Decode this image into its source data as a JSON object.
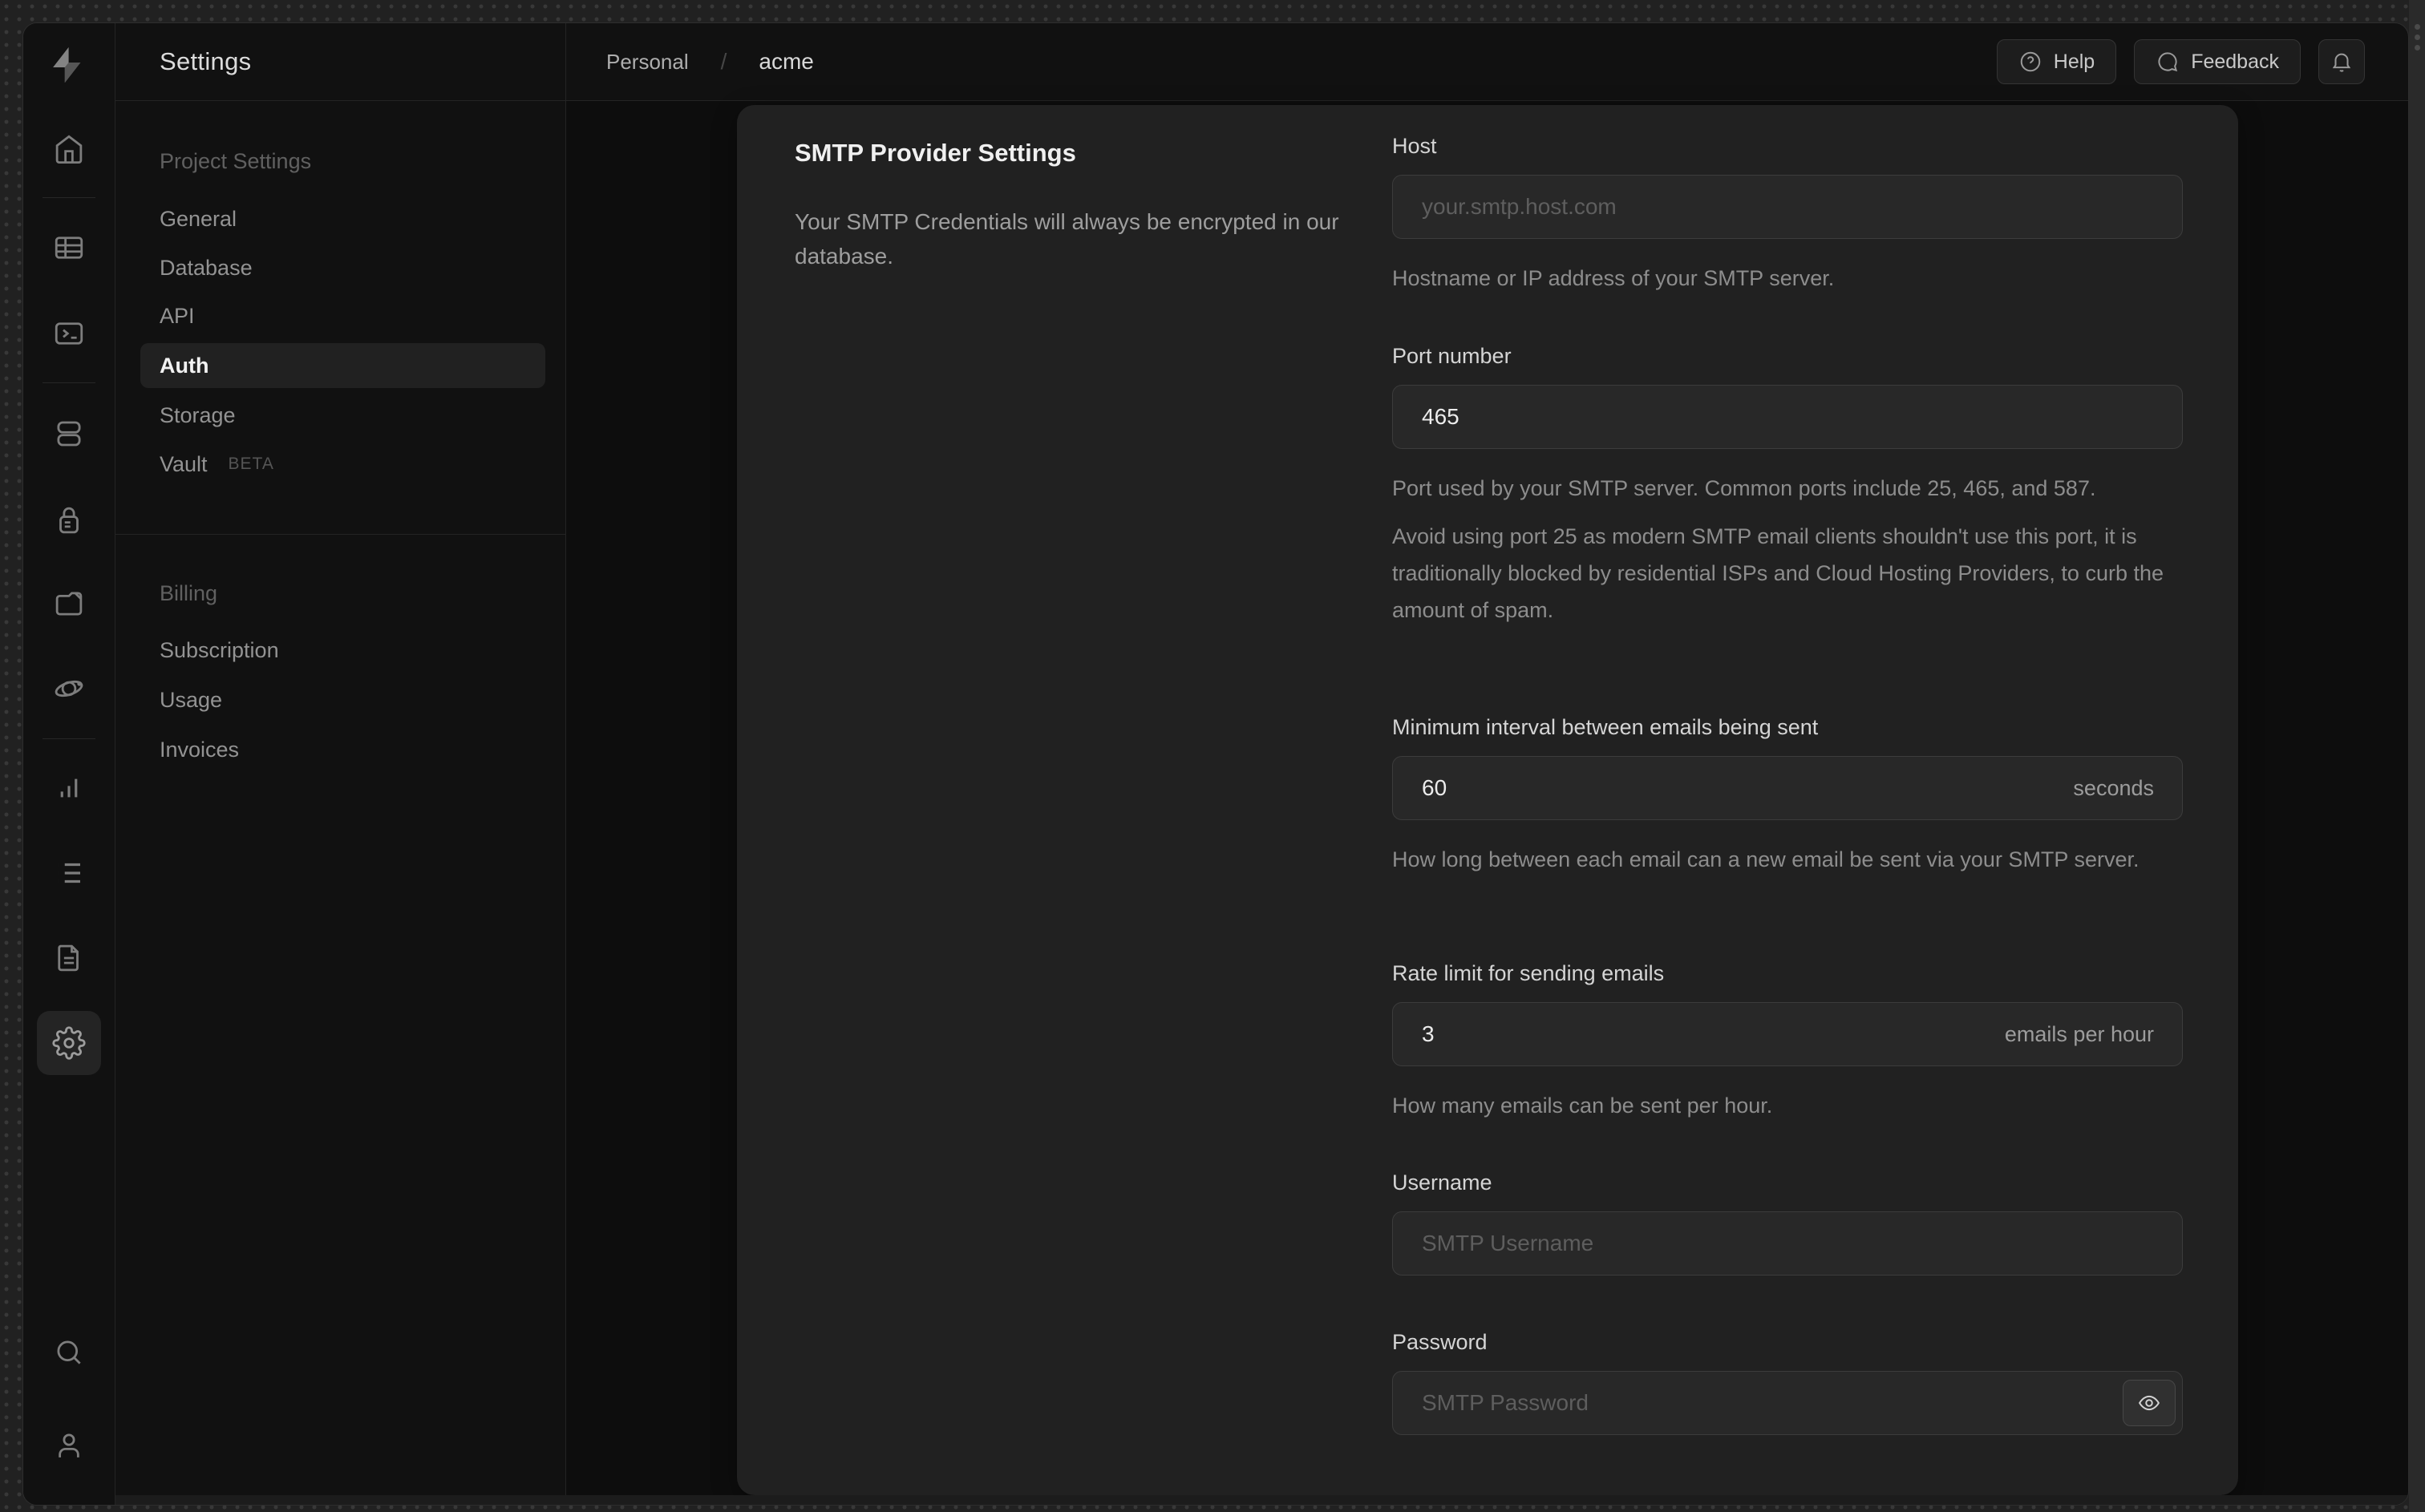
{
  "page_title": "Settings",
  "breadcrumb": {
    "org": "Personal",
    "separator": "/",
    "project": "acme"
  },
  "topbar_actions": {
    "help": "Help",
    "feedback": "Feedback",
    "notifications_icon": "bell-icon"
  },
  "rail_icons": [
    "supabase-logo",
    "home",
    "table-editor",
    "sql-editor",
    "database",
    "authentication",
    "storage",
    "edge-functions",
    "reports",
    "logs",
    "api-docs",
    "project-settings",
    "search",
    "account"
  ],
  "nav": {
    "project_section": {
      "header": "Project Settings",
      "items": [
        "General",
        "Database",
        "API",
        "Auth",
        "Storage",
        "Vault"
      ],
      "active_item": "Auth",
      "vault_beta": "BETA"
    },
    "billing_section": {
      "header": "Billing",
      "items": [
        "Subscription",
        "Usage",
        "Invoices"
      ]
    }
  },
  "smtp_card": {
    "title": "SMTP Provider Settings",
    "description": "Your SMTP Credentials will always be encrypted in our database.",
    "fields": {
      "host": {
        "label": "Host",
        "placeholder": "your.smtp.host.com",
        "helper": "Hostname or IP address of your SMTP server."
      },
      "port": {
        "label": "Port number",
        "value": "465",
        "helper_1": "Port used by your SMTP server. Common ports include 25, 465, and 587.",
        "helper_2": "Avoid using port 25 as modern SMTP email clients shouldn't use this port, it is traditionally blocked by residential ISPs and Cloud Hosting Providers, to curb the amount of spam."
      },
      "min_interval": {
        "label": "Minimum interval between emails being sent",
        "value": "60",
        "suffix": "seconds",
        "helper": "How long between each email can a new email be sent via your SMTP server."
      },
      "rate_limit": {
        "label": "Rate limit for sending emails",
        "value": "3",
        "suffix": "emails per hour",
        "helper": "How many emails can be sent per hour."
      },
      "username": {
        "label": "Username",
        "placeholder": "SMTP Username"
      },
      "password": {
        "label": "Password",
        "placeholder": "SMTP Password"
      }
    }
  },
  "colors": {
    "frame_bg": "#212121",
    "window_bg": "#111111",
    "content_bg": "#0d0d0d",
    "card_bg": "#212121",
    "input_bg": "#282828",
    "border": "#2e2e2e"
  }
}
